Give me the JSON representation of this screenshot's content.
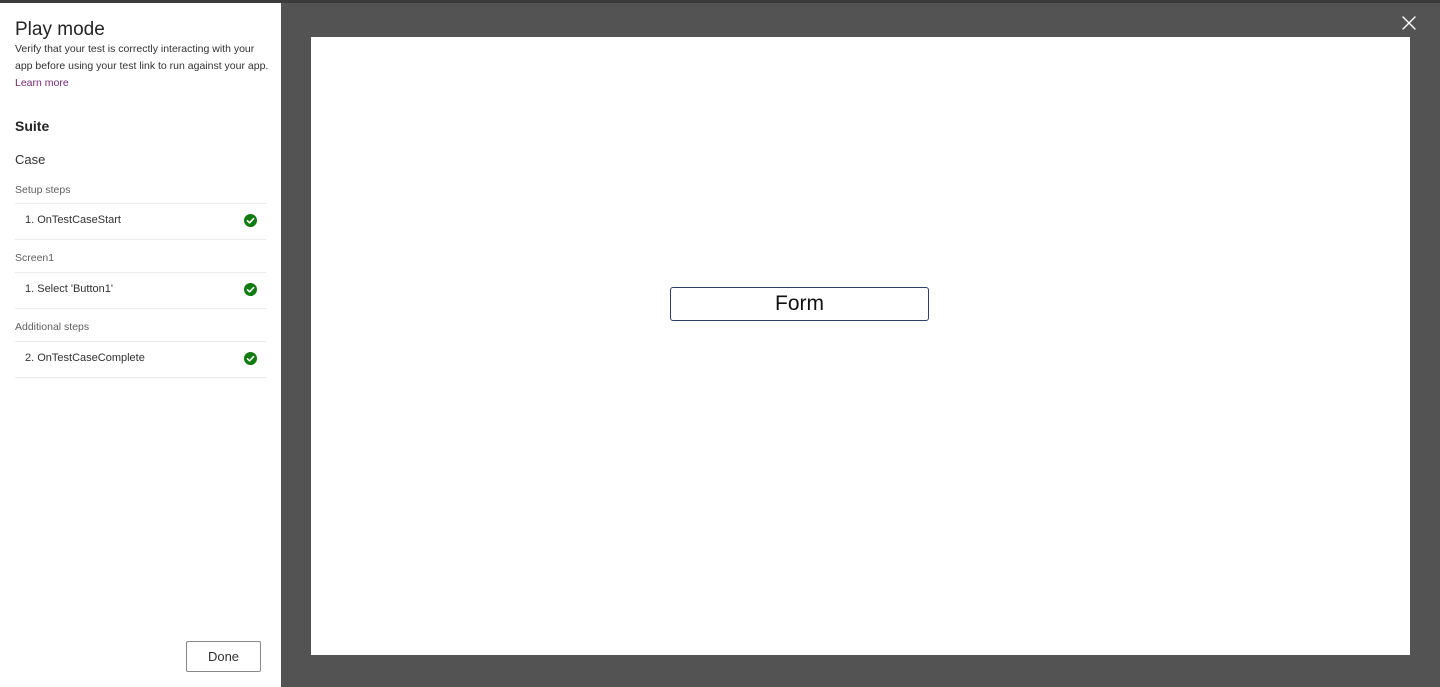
{
  "panel": {
    "title": "Play mode",
    "description": "Verify that your test is correctly interacting with your app before using your test link to run against your app.",
    "learn_more": "Learn more",
    "suite_label": "Suite",
    "case_label": "Case",
    "groups": [
      {
        "label": "Setup steps",
        "steps": [
          {
            "label": "1. OnTestCaseStart",
            "status": "passed"
          }
        ]
      },
      {
        "label": "Screen1",
        "steps": [
          {
            "label": "1. Select 'Button1'",
            "status": "passed"
          }
        ]
      },
      {
        "label": "Additional steps",
        "steps": [
          {
            "label": "2. OnTestCaseComplete",
            "status": "passed"
          }
        ]
      }
    ],
    "done_label": "Done"
  },
  "canvas": {
    "button_label": "Form"
  },
  "icons": {
    "close": "close-icon",
    "check": "check-circle-icon"
  },
  "colors": {
    "success": "#107c10",
    "link": "#742774",
    "backdrop": "#535353"
  }
}
